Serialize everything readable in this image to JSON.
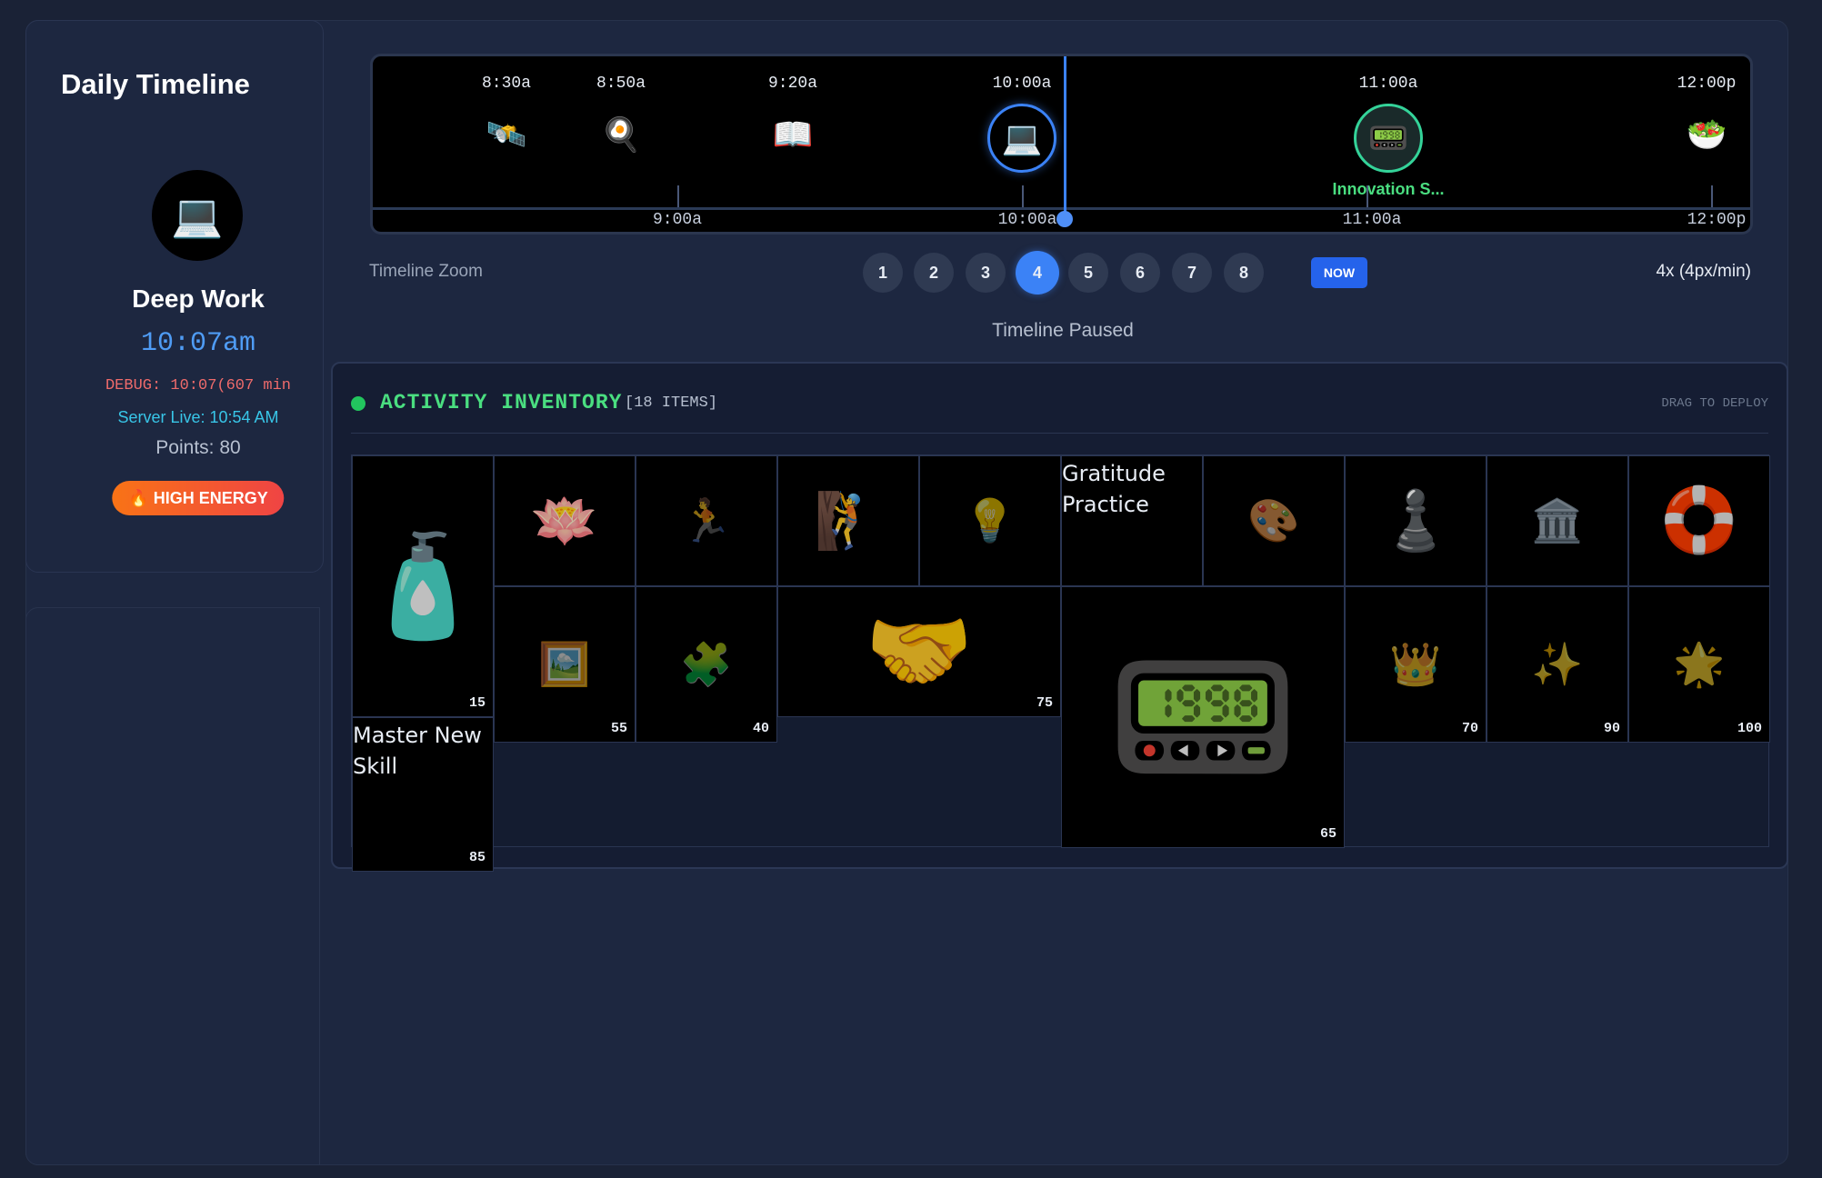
{
  "sidebar": {
    "title": "Daily Timeline",
    "current_icon": "💻",
    "current_activity": "Deep Work",
    "current_time": "10:07am",
    "debug": "DEBUG: 10:07(607 min",
    "server_live": "Server Live: 10:54 AM",
    "points": "Points: 80",
    "energy_badge": "🔥 HIGH ENERGY"
  },
  "timeline": {
    "events": [
      {
        "time": "8:30a",
        "icon": "🛰️",
        "name": "satellite-icon"
      },
      {
        "time": "8:50a",
        "icon": "🍳",
        "name": "frying-pan-icon"
      },
      {
        "time": "9:20a",
        "icon": "📖",
        "name": "book-icon"
      },
      {
        "time": "10:00a",
        "icon": "💻",
        "name": "laptop-icon"
      },
      {
        "time": "11:00a",
        "icon": "📟",
        "name": "quantum-module-icon",
        "label": "Innovation S..."
      },
      {
        "time": "12:00p",
        "icon": "🥗",
        "name": "salad-icon"
      }
    ],
    "axis_ticks": [
      "9:00a",
      "10:00a",
      "11:00a",
      "12:00p"
    ]
  },
  "zoom": {
    "label": "Timeline Zoom",
    "levels": [
      "1",
      "2",
      "3",
      "4",
      "5",
      "6",
      "7",
      "8"
    ],
    "active_level": "4",
    "now_button": "NOW",
    "scale": "4x (4px/min)",
    "status": "Timeline Paused"
  },
  "inventory": {
    "title": "ACTIVITY INVENTORY",
    "count": "[18 ITEMS]",
    "hint": "DRAG TO DEPLOY",
    "items": [
      {
        "name": "water-bottle",
        "icon": "🧴",
        "points": "15"
      },
      {
        "name": "meditation",
        "icon": "🪷",
        "points": ""
      },
      {
        "name": "running",
        "icon": "🏃",
        "points": ""
      },
      {
        "name": "trail-run",
        "icon": "🧗",
        "points": ""
      },
      {
        "name": "idea",
        "icon": "💡",
        "points": ""
      },
      {
        "name": "gratitude-practice",
        "alt": "Gratitude Practice",
        "points": ""
      },
      {
        "name": "art",
        "icon": "🎨",
        "points": ""
      },
      {
        "name": "chess",
        "icon": "♟️",
        "points": ""
      },
      {
        "name": "museum",
        "icon": "🏛️",
        "points": ""
      },
      {
        "name": "float-ring",
        "icon": "🛟",
        "points": ""
      },
      {
        "name": "portrait",
        "icon": "🖼️",
        "points": "55"
      },
      {
        "name": "puzzle",
        "icon": "🧩",
        "points": "40"
      },
      {
        "name": "handshake",
        "icon": "🤝",
        "points": "75"
      },
      {
        "name": "quantum-processor",
        "icon": "📟",
        "points": "65"
      },
      {
        "name": "crown",
        "icon": "👑",
        "points": "70"
      },
      {
        "name": "sparkles",
        "icon": "✨",
        "points": "90"
      },
      {
        "name": "star",
        "icon": "🌟",
        "points": "100"
      },
      {
        "name": "master-new-skill",
        "alt": "Master New Skill",
        "points": "85"
      }
    ]
  }
}
